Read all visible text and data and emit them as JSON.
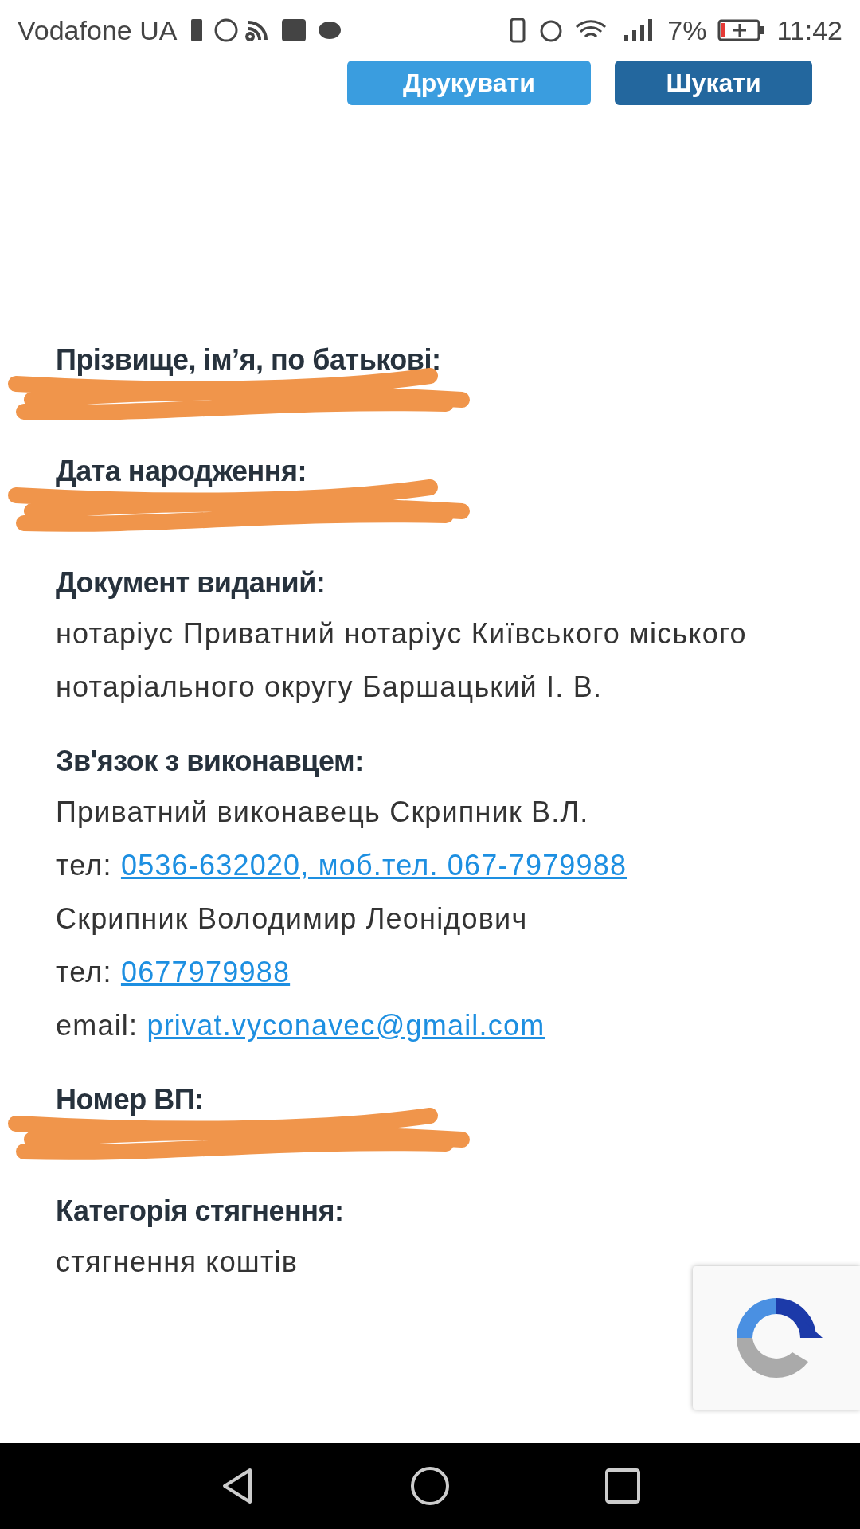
{
  "status_bar": {
    "carrier": "Vodafone UA",
    "battery": "7%",
    "time": "11:42"
  },
  "buttons": [
    {
      "label": "Друкувати",
      "kind": "light"
    },
    {
      "label": "Шукати",
      "kind": "dark"
    }
  ],
  "fields": [
    {
      "label": "Прізвище, ім’я, по батькові:",
      "kind": "redacted"
    },
    {
      "label": "Дата народження:",
      "kind": "redacted"
    },
    {
      "label": "Документ виданий:",
      "kind": "text",
      "lines": [
        {
          "text": "нотаріус Приватний нотаріус Київського міського нотаріального округу Баршацький І. В."
        }
      ]
    },
    {
      "label": "Зв'язок з виконавцем:",
      "kind": "text",
      "lines": [
        {
          "text": "Приватний виконавець Скрипник В.Л."
        },
        {
          "text": "тел: ",
          "link": "0536-632020, моб.тел. 067-7979988"
        },
        {
          "text": "Скрипник Володимир Леонідович"
        },
        {
          "text": "тел: ",
          "link": "0677979988"
        },
        {
          "text": "email: ",
          "link": "privat.vyconavec@gmail.com"
        }
      ]
    },
    {
      "label": "Номер ВП:",
      "kind": "redacted"
    },
    {
      "label": "Категорія стягнення:",
      "kind": "text",
      "lines": [
        {
          "text": "стягнення коштів"
        }
      ]
    }
  ]
}
